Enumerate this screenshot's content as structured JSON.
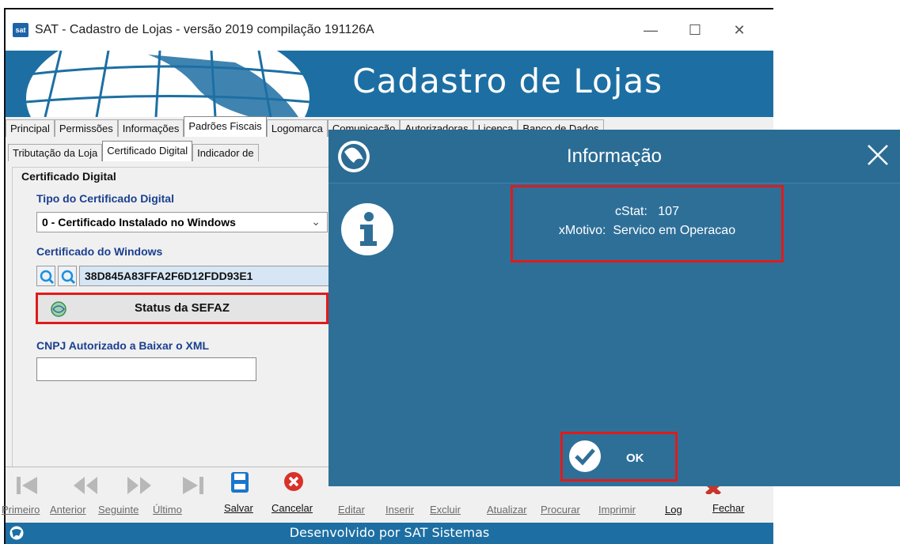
{
  "window": {
    "app_icon_text": "sat",
    "title": "SAT - Cadastro de Lojas - versão 2019 compilação 191126A",
    "controls": {
      "minimize": "—",
      "maximize": "☐",
      "close": "✕"
    }
  },
  "banner": {
    "title": "Cadastro de Lojas"
  },
  "main_tabs": [
    "Principal",
    "Permissões",
    "Informações",
    "Padrões Fiscais",
    "Logomarca",
    "Comunicação",
    "Autorizadoras",
    "Licença",
    "Banco de Dados"
  ],
  "sub_tabs": [
    "Tributação da Loja",
    "Certificado Digital",
    "Indicador de"
  ],
  "certificate": {
    "group_title": "Certificado Digital",
    "type_label": "Tipo do Certificado Digital",
    "type_value": "0 - Certificado Instalado no Windows",
    "windows_label": "Certificado do Windows",
    "cert_value": "38D845A83FFA2F6D12FDD93E1",
    "status_button": "Status da SEFAZ",
    "cnpj_label": "CNPJ Autorizado a Baixar o XML",
    "cnpj_value": ""
  },
  "toolbar": {
    "primeiro": "Primeiro",
    "anterior": "Anterior",
    "seguinte": "Seguinte",
    "ultimo": "Último",
    "salvar": "Salvar",
    "cancelar": "Cancelar",
    "editar": "Editar",
    "inserir": "Inserir",
    "excluir": "Excluir",
    "atualizar": "Atualizar",
    "procurar": "Procurar",
    "imprimir": "Imprimir",
    "log": "Log",
    "fechar": "Fechar"
  },
  "footer": {
    "text": "Desenvolvido por SAT Sistemas"
  },
  "dialog": {
    "title": "Informação",
    "line1": "cStat:   107",
    "line2": "xMotivo:  Servico em Operacao",
    "ok_label": "OK",
    "close_glyph": "✕"
  },
  "colors": {
    "banner": "#1d6fa3",
    "dialog": "#2e6f98",
    "highlight": "#e01b1b",
    "label_blue": "#1a3f8f"
  }
}
